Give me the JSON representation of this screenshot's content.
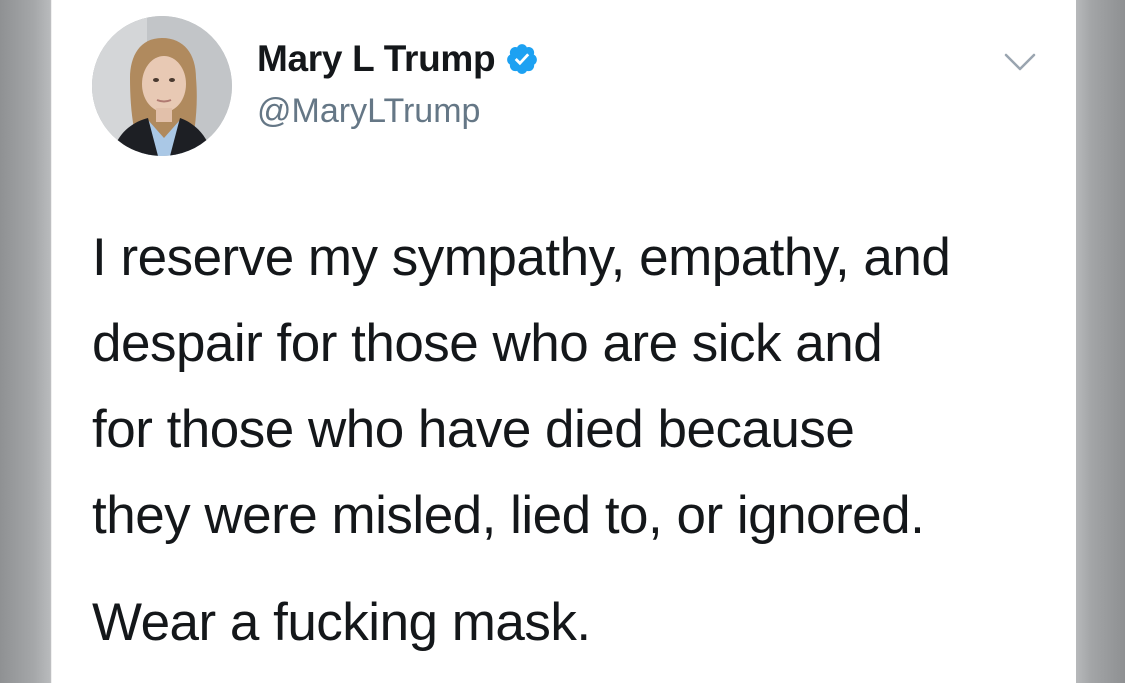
{
  "tweet": {
    "author": {
      "name": "Mary L Trump",
      "handle": "@MaryLTrump",
      "verified": true,
      "avatar_icon": "profile-photo"
    },
    "menu_icon": "chevron-down-icon",
    "body_lines": [
      "I reserve my sympathy, empathy, and",
      "despair for those who are sick and",
      "for those who have died because",
      "they were misled, lied to, or ignored."
    ],
    "body_closing": "Wear a fucking mask."
  },
  "colors": {
    "verified_blue": "#1da1f2",
    "text_primary": "#14171a",
    "text_secondary": "#657786"
  }
}
